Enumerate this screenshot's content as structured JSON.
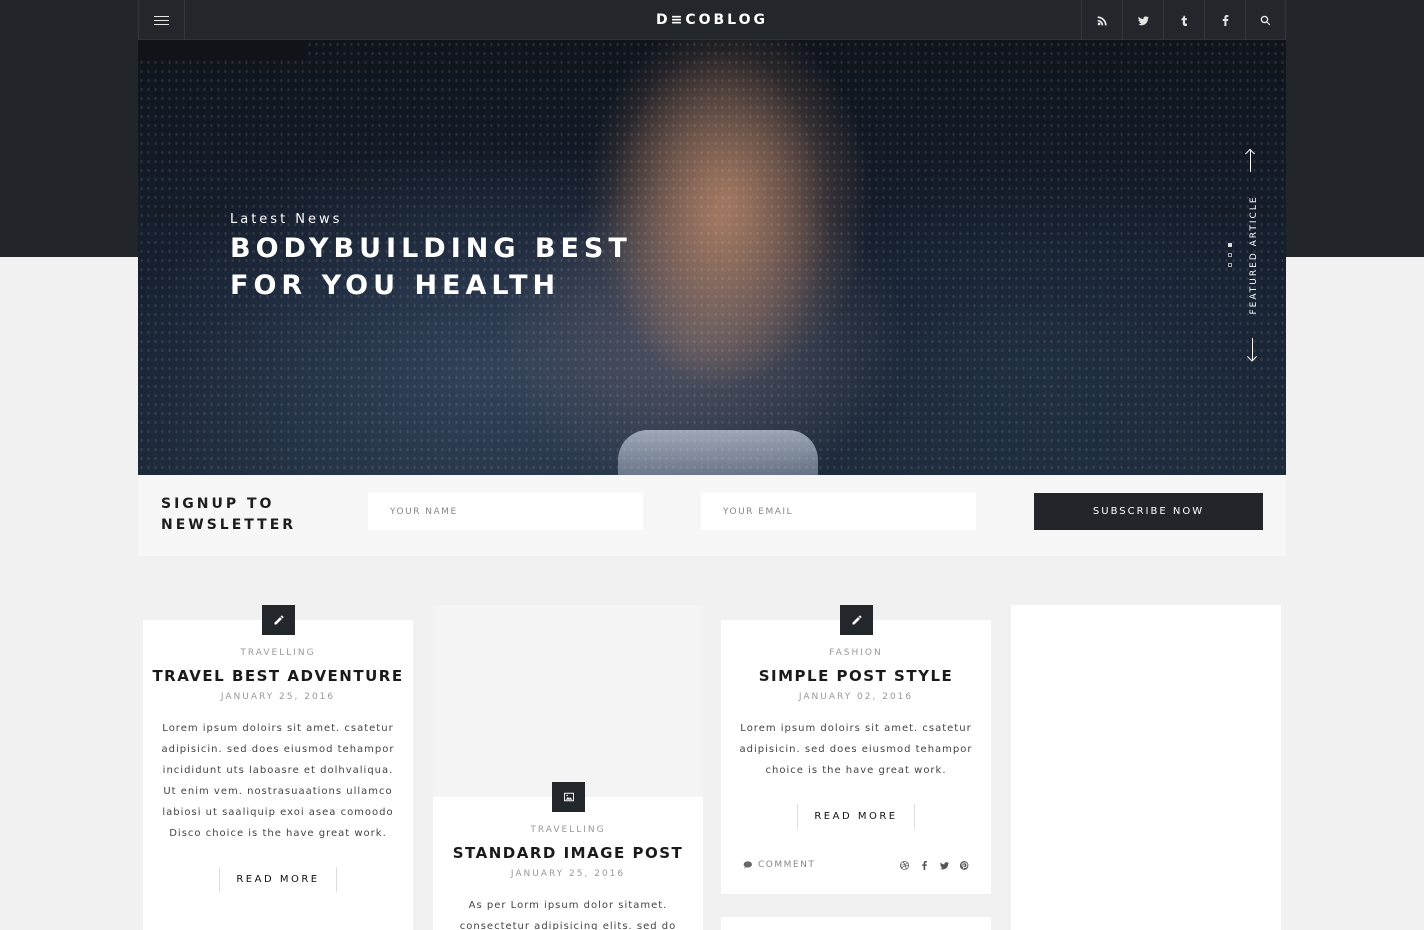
{
  "header": {
    "logo": "D≡COBLOG",
    "icons": [
      "menu-icon",
      "rss-icon",
      "twitter-icon",
      "tumblr-icon",
      "facebook-icon",
      "search-icon"
    ]
  },
  "hero": {
    "kicker": "Latest News",
    "title": "BODYBUILDING BEST FOR YOU HEALTH",
    "side_label": "FEATURED ARTICLE"
  },
  "newsletter": {
    "title_line1": "SIGNUP TO",
    "title_line2": "NEWSLETTER",
    "name_placeholder": "YOUR NAME",
    "email_placeholder": "YOUR EMAIL",
    "button": "SUBSCRIBE NOW"
  },
  "posts": [
    {
      "category": "TRAVELLING",
      "title": "TRAVEL BEST ADVENTURE",
      "date": "JANUARY 25, 2016",
      "excerpt_lines": [
        "Lorem ipsum doloirs sit amet. csatetur",
        "adipisicin. sed does eiusmod tehampor",
        "incididunt uts laboasre et dolhvaliqua.",
        "Ut enim vem. nostrasuaations ullamco",
        "labiosi ut saaliquip exoi asea comoodo",
        "Disco choice is the have great work."
      ],
      "read_more": "READ MORE",
      "icon": "pencil-icon"
    },
    {
      "category": "TRAVELLING",
      "title": "STANDARD IMAGE POST",
      "date": "JANUARY 25, 2016",
      "excerpt_lines": [
        "As per Lorm ipsum dolor sitamet.",
        "consectetur adipisicing elits. sed do"
      ],
      "icon": "image-icon"
    },
    {
      "category": "FASHION",
      "title": "SIMPLE POST STYLE",
      "date": "JANUARY 02, 2016",
      "excerpt_lines": [
        "Lorem ipsum doloirs sit amet. csatetur",
        "adipisicin. sed does eiusmod tehampor",
        "choice is the have great work."
      ],
      "read_more": "READ MORE",
      "comment": "COMMENT",
      "icon": "pencil-icon",
      "share_icons": [
        "dribbble-icon",
        "facebook-icon",
        "twitter-icon",
        "pinterest-icon"
      ]
    }
  ],
  "colors": {
    "dark": "#22252a",
    "background": "#f1f1f1",
    "card": "#ffffff"
  }
}
